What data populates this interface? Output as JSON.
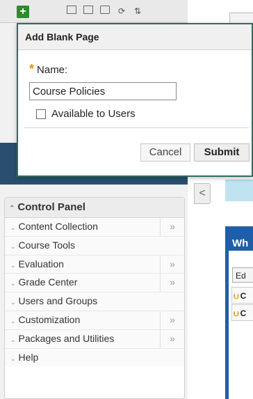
{
  "dialog": {
    "title": "Add Blank Page",
    "name_label": "Name:",
    "name_value": "Course Policies",
    "available_label": "Available to Users",
    "cancel_label": "Cancel",
    "submit_label": "Submit"
  },
  "toolbar": {
    "plus_label": "+",
    "icons": [
      "add-icon",
      "list-icon",
      "folder-icon",
      "window-icon",
      "refresh-icon",
      "sort-icon"
    ]
  },
  "control_panel": {
    "title": "Control Panel",
    "items": [
      {
        "label": "Content Collection",
        "more": "»"
      },
      {
        "label": "Course Tools",
        "more": ""
      },
      {
        "label": "Evaluation",
        "more": "»"
      },
      {
        "label": "Grade Center",
        "more": "»"
      },
      {
        "label": "Users and Groups",
        "more": ""
      },
      {
        "label": "Customization",
        "more": "»"
      },
      {
        "label": "Packages and Utilities",
        "more": "»"
      },
      {
        "label": "Help",
        "more": ""
      }
    ]
  },
  "background": {
    "panel_title": "Wh",
    "edit_button": "Ed",
    "item1": "C",
    "item2": "C",
    "collapse_glyph": "<"
  },
  "colors": {
    "dialog_border": "#2f6d5e",
    "required_star": "#f08a00",
    "module_blue": "#1f5ea8"
  }
}
